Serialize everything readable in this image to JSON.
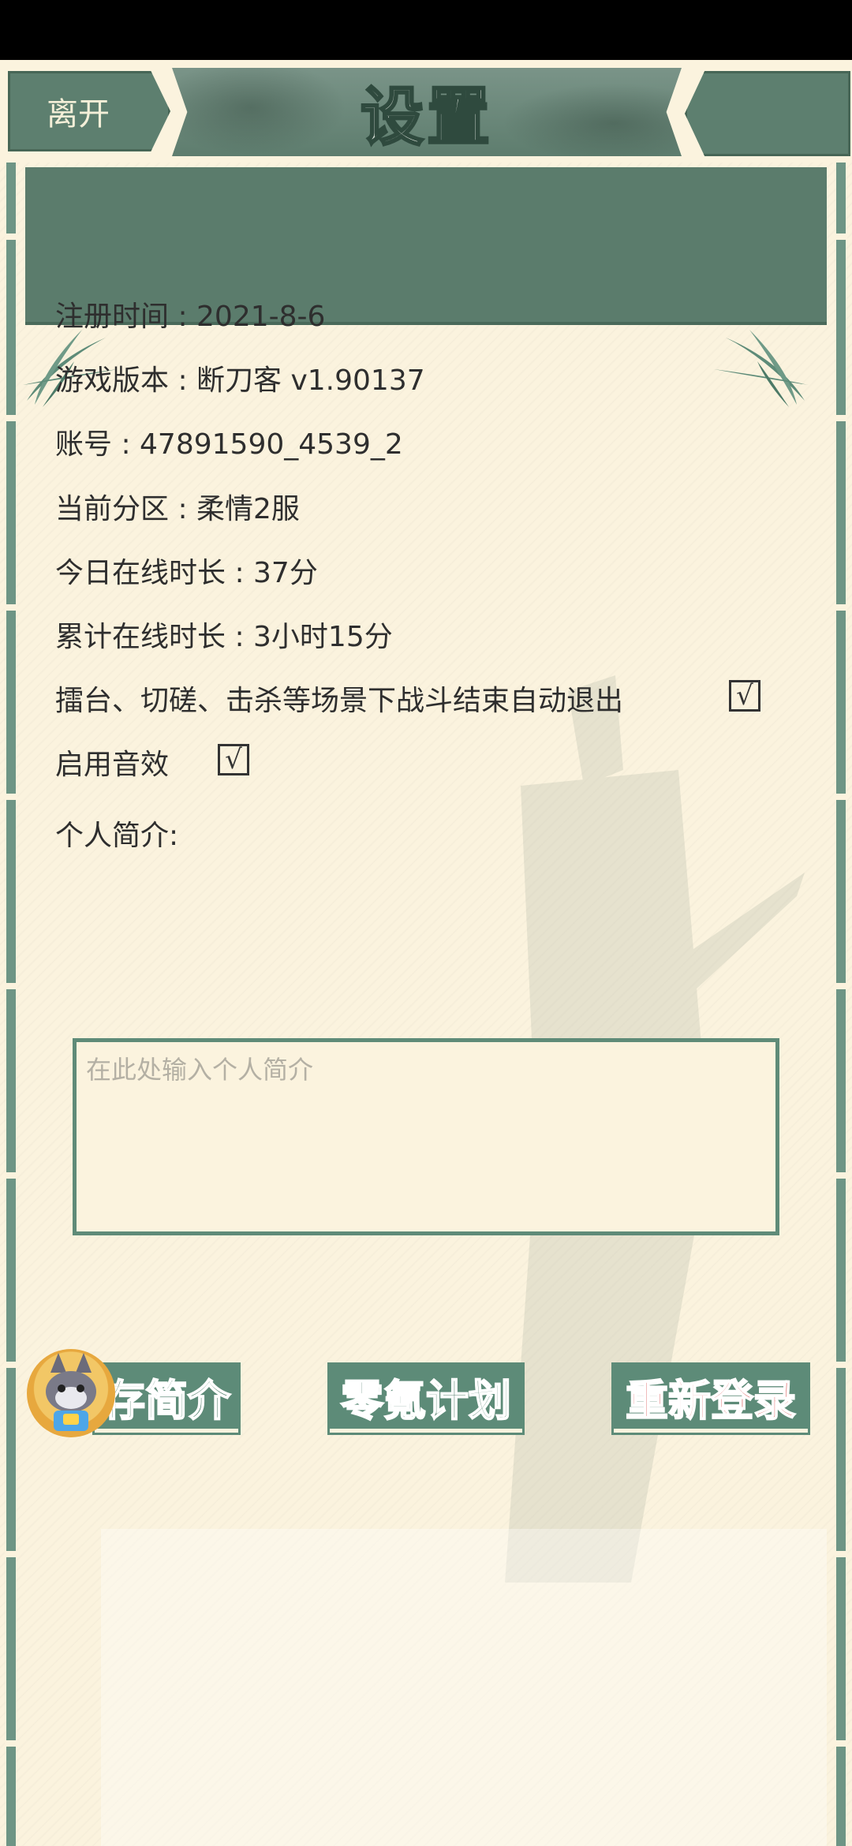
{
  "header": {
    "leave_label": "离开",
    "title": "设置"
  },
  "info": {
    "register_time": "注册时间 : 2021-8-6",
    "game_version": "游戏版本 : 断刀客 v1.90137",
    "account": "账号 : 47891590_4539_2",
    "current_server": "当前分区 : 柔情2服",
    "today_online": "今日在线时长 : 37分",
    "total_online": "累计在线时长 : 3小时15分"
  },
  "options": {
    "auto_exit_label": "擂台、切磋、击杀等场景下战斗结束自动退出",
    "auto_exit_checked": true,
    "sound_label": "启用音效",
    "sound_checked": true,
    "check_mark": "√"
  },
  "profile": {
    "label": "个人简介:",
    "placeholder": "在此处输入个人简介",
    "value": ""
  },
  "buttons": {
    "save_label": "存简介",
    "plan_label": "零氪计划",
    "relogin_label": "重新登录"
  },
  "colors": {
    "background": "#fbf3de",
    "accent_green": "#5d8b78",
    "panel_green": "#5b7c6c",
    "danger_red": "#d43a3a"
  }
}
